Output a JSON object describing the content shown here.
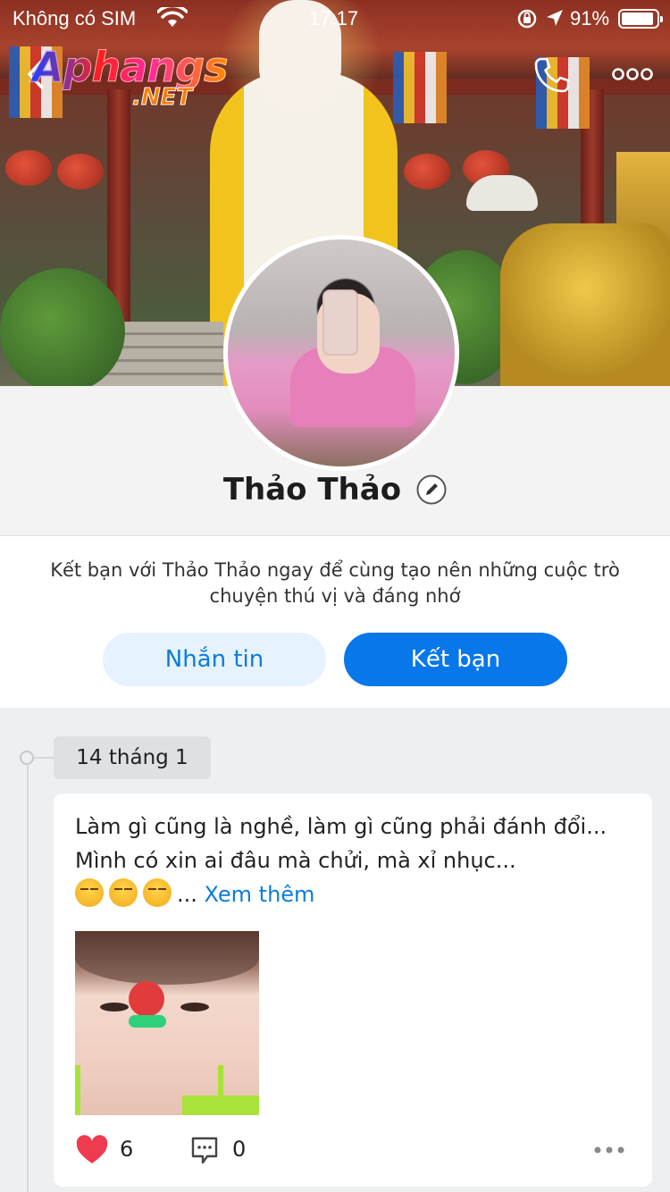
{
  "status_bar": {
    "carrier": "Không có SIM",
    "time": "17:17",
    "battery": "91%",
    "battery_level": 0.91
  },
  "header": {
    "logo_text": "Aphangs",
    "logo_sub": ".NET",
    "icons": [
      "back-icon",
      "phone-icon",
      "more-icon"
    ]
  },
  "profile": {
    "name": "Thảo Thảo",
    "intro": "Kết bạn với Thảo Thảo ngay để cùng tạo nên những cuộc trò chuyện thú vị và đáng nhớ",
    "message_button": "Nhắn tin",
    "add_friend_button": "Kết bạn"
  },
  "timeline": {
    "date": "14 tháng 1",
    "post": {
      "text": "Làm gì cũng là nghề, làm gì cũng phải đánh đổi... Mình có xin ai đâu mà chửi, mà xỉ nhục...",
      "ellipsis": "...",
      "see_more": "Xem thêm",
      "emoji_count": 3,
      "likes": "6",
      "comments": "0"
    }
  },
  "colors": {
    "accent": "#0877ea",
    "accent_light": "#e6f2fd",
    "link": "#0a7ddd",
    "heart": "#ee3b4f"
  }
}
